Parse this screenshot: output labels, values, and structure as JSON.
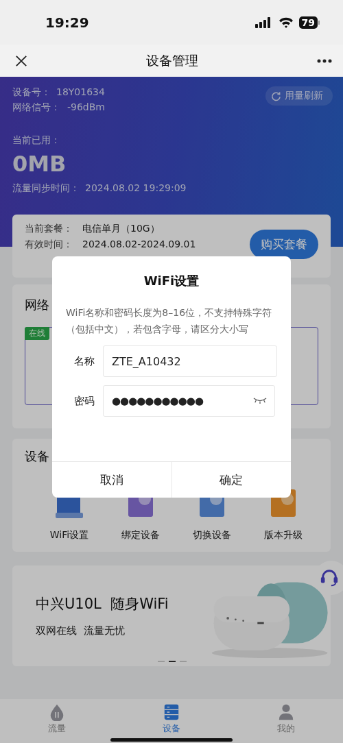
{
  "status_bar": {
    "time": "19:29",
    "battery": "79"
  },
  "nav": {
    "title": "设备管理"
  },
  "header": {
    "device_label": "设备号：",
    "device_id": "18Y01634",
    "signal_label": "网络信号：",
    "signal": "-96dBm",
    "refresh_button": "用量刷新",
    "used_label": "当前已用：",
    "used": "0MB",
    "sync_label": "流量同步时间：",
    "sync_time": "2024.08.02 19:29:09"
  },
  "plan": {
    "plan_label": "当前套餐：",
    "plan": "电信单月（10G）",
    "valid_label": "有效时间：",
    "valid": "2024.08.02-2024.09.01",
    "buy_button": "购买套餐"
  },
  "network_card": {
    "title": "网络",
    "status_badge": "在线"
  },
  "device_card": {
    "title": "设备",
    "actions": [
      {
        "label": "WiFi设置",
        "kind": "wifi"
      },
      {
        "label": "绑定设备",
        "kind": "bind"
      },
      {
        "label": "切换设备",
        "kind": "switch"
      },
      {
        "label": "版本升级",
        "kind": "upgrade"
      }
    ]
  },
  "banner": {
    "title": "中兴U10L  随身WiFi",
    "subtitle": "双网在线  流量无忧",
    "dots": [
      {
        "selected": false
      },
      {
        "selected": true
      },
      {
        "selected": false
      }
    ]
  },
  "tabs": [
    {
      "label": "流量",
      "kind": "traffic",
      "selected": false
    },
    {
      "label": "设备",
      "kind": "device",
      "selected": true
    },
    {
      "label": "我的",
      "kind": "me",
      "selected": false
    }
  ],
  "dialog": {
    "title": "WiFi设置",
    "message": "WiFi名称和密码长度为8–16位，不支持特殊字符（包括中文），若包含字母，请区分大小写",
    "fields": [
      {
        "label": "名称",
        "value": "ZTE_A10432",
        "kind": "text"
      },
      {
        "label": "密码",
        "value": "●●●●●●●●●●●",
        "kind": "password"
      }
    ],
    "buttons": [
      "取消",
      "确定"
    ]
  }
}
